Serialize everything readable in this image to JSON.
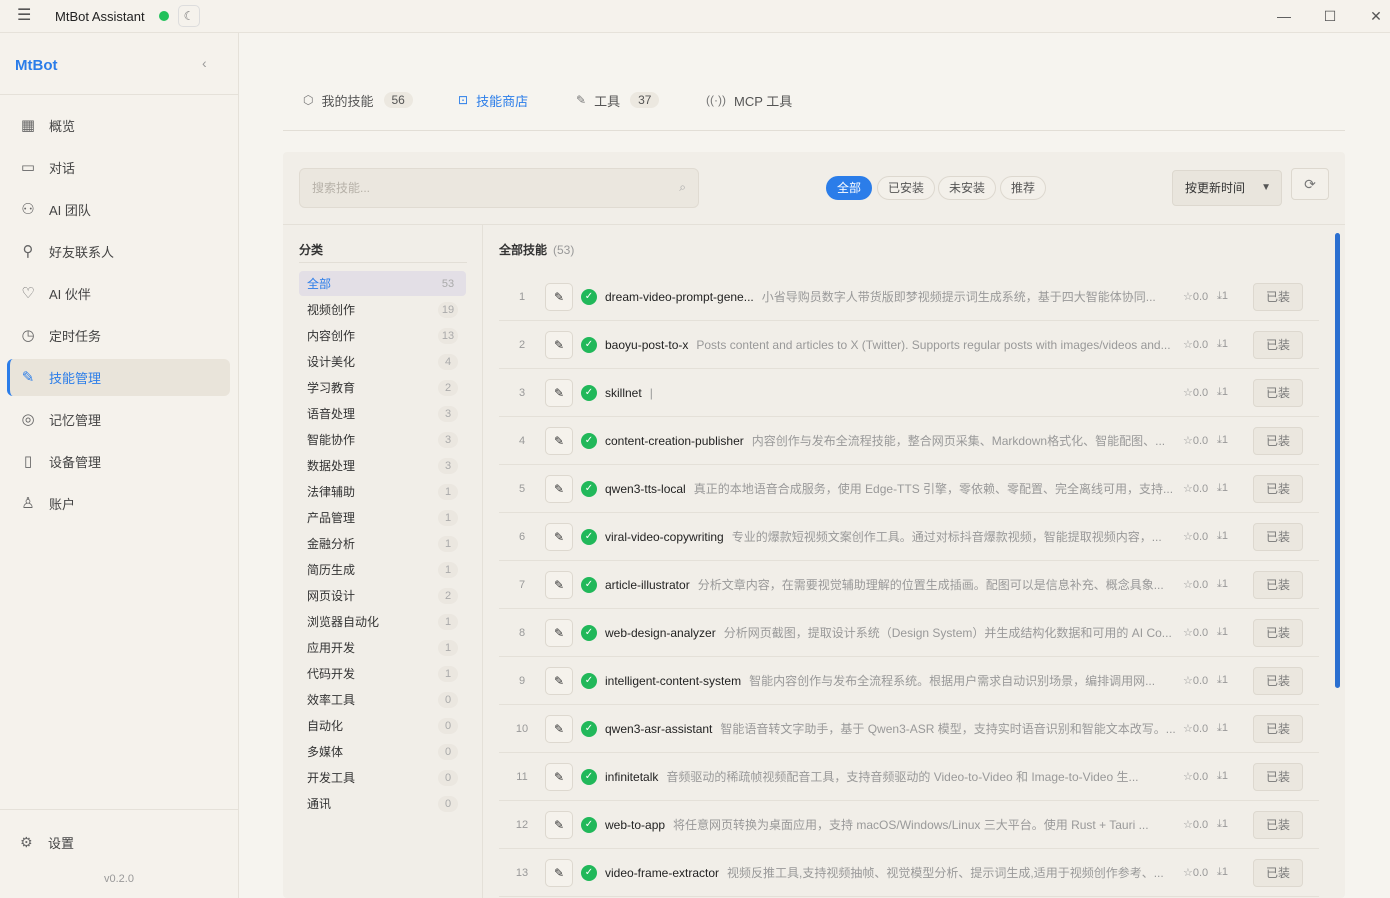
{
  "titlebar": {
    "title": "MtBot Assistant",
    "minimize": "—",
    "maximize": "☐",
    "close": "✕"
  },
  "sidebar": {
    "brand": "MtBot",
    "items": [
      {
        "label": "概览",
        "icon": "dashboard-icon"
      },
      {
        "label": "对话",
        "icon": "chat-icon"
      },
      {
        "label": "AI 团队",
        "icon": "team-icon"
      },
      {
        "label": "好友联系人",
        "icon": "contact-icon"
      },
      {
        "label": "AI 伙伴",
        "icon": "heart-icon"
      },
      {
        "label": "定时任务",
        "icon": "clock-icon"
      },
      {
        "label": "技能管理",
        "icon": "wrench-icon",
        "active": true
      },
      {
        "label": "记忆管理",
        "icon": "brain-icon"
      },
      {
        "label": "设备管理",
        "icon": "device-icon"
      },
      {
        "label": "账户",
        "icon": "user-icon"
      }
    ],
    "settings": "设置",
    "version": "v0.2.0"
  },
  "tabs": [
    {
      "label": "我的技能",
      "count": "56"
    },
    {
      "label": "技能商店",
      "active": true
    },
    {
      "label": "工具",
      "count": "37"
    },
    {
      "label": "MCP 工具"
    }
  ],
  "search": {
    "placeholder": "搜索技能..."
  },
  "filters": [
    "全部",
    "已安装",
    "未安装",
    "推荐"
  ],
  "sort": {
    "label": "按更新时间"
  },
  "categories": {
    "title": "分类",
    "items": [
      {
        "name": "全部",
        "count": "53"
      },
      {
        "name": "视频创作",
        "count": "19"
      },
      {
        "name": "内容创作",
        "count": "13"
      },
      {
        "name": "设计美化",
        "count": "4"
      },
      {
        "name": "学习教育",
        "count": "2"
      },
      {
        "name": "语音处理",
        "count": "3"
      },
      {
        "name": "智能协作",
        "count": "3"
      },
      {
        "name": "数据处理",
        "count": "3"
      },
      {
        "name": "法律辅助",
        "count": "1"
      },
      {
        "name": "产品管理",
        "count": "1"
      },
      {
        "name": "金融分析",
        "count": "1"
      },
      {
        "name": "简历生成",
        "count": "1"
      },
      {
        "name": "网页设计",
        "count": "2"
      },
      {
        "name": "浏览器自动化",
        "count": "1"
      },
      {
        "name": "应用开发",
        "count": "1"
      },
      {
        "name": "代码开发",
        "count": "1"
      },
      {
        "name": "效率工具",
        "count": "0"
      },
      {
        "name": "自动化",
        "count": "0"
      },
      {
        "name": "多媒体",
        "count": "0"
      },
      {
        "name": "开发工具",
        "count": "0"
      },
      {
        "name": "通讯",
        "count": "0"
      }
    ]
  },
  "skills": {
    "title": "全部技能",
    "count": "(53)",
    "items": [
      {
        "num": "1",
        "name": "dream-video-prompt-gene...",
        "desc": "小省导购员数字人带货版即梦视频提示词生成系统，基于四大智能体协同...",
        "rating": "0.0",
        "downloads": "1",
        "action": "已装"
      },
      {
        "num": "2",
        "name": "baoyu-post-to-x",
        "desc": "Posts content and articles to X (Twitter). Supports regular posts with images/videos and...",
        "rating": "0.0",
        "downloads": "1",
        "action": "已装"
      },
      {
        "num": "3",
        "name": "skillnet",
        "desc": "|",
        "rating": "0.0",
        "downloads": "1",
        "action": "已装"
      },
      {
        "num": "4",
        "name": "content-creation-publisher",
        "desc": "内容创作与发布全流程技能，整合网页采集、Markdown格式化、智能配图、...",
        "rating": "0.0",
        "downloads": "1",
        "action": "已装"
      },
      {
        "num": "5",
        "name": "qwen3-tts-local",
        "desc": "真正的本地语音合成服务，使用 Edge-TTS 引擎，零依赖、零配置、完全离线可用，支持...",
        "rating": "0.0",
        "downloads": "1",
        "action": "已装"
      },
      {
        "num": "6",
        "name": "viral-video-copywriting",
        "desc": "专业的爆款短视频文案创作工具。通过对标抖音爆款视频，智能提取视频内容，...",
        "rating": "0.0",
        "downloads": "1",
        "action": "已装"
      },
      {
        "num": "7",
        "name": "article-illustrator",
        "desc": "分析文章内容，在需要视觉辅助理解的位置生成插画。配图可以是信息补充、概念具象...",
        "rating": "0.0",
        "downloads": "1",
        "action": "已装"
      },
      {
        "num": "8",
        "name": "web-design-analyzer",
        "desc": "分析网页截图，提取设计系统（Design System）并生成结构化数据和可用的 AI Co...",
        "rating": "0.0",
        "downloads": "1",
        "action": "已装"
      },
      {
        "num": "9",
        "name": "intelligent-content-system",
        "desc": "智能内容创作与发布全流程系统。根据用户需求自动识别场景，编排调用网...",
        "rating": "0.0",
        "downloads": "1",
        "action": "已装"
      },
      {
        "num": "10",
        "name": "qwen3-asr-assistant",
        "desc": "智能语音转文字助手，基于 Qwen3-ASR 模型，支持实时语音识别和智能文本改写。...",
        "rating": "0.0",
        "downloads": "1",
        "action": "已装"
      },
      {
        "num": "11",
        "name": "infinitetalk",
        "desc": "音频驱动的稀疏帧视频配音工具，支持音频驱动的 Video-to-Video 和 Image-to-Video 生...",
        "rating": "0.0",
        "downloads": "1",
        "action": "已装"
      },
      {
        "num": "12",
        "name": "web-to-app",
        "desc": "将任意网页转换为桌面应用，支持 macOS/Windows/Linux 三大平台。使用 Rust + Tauri ...",
        "rating": "0.0",
        "downloads": "1",
        "action": "已装"
      },
      {
        "num": "13",
        "name": "video-frame-extractor",
        "desc": "视频反推工具,支持视频抽帧、视觉模型分析、提示词生成,适用于视频创作参考、...",
        "rating": "0.0",
        "downloads": "1",
        "action": "已装"
      }
    ]
  },
  "colors": {
    "accent": "#2b7de9",
    "success": "#21b85a",
    "status_dot": "#21c15a"
  }
}
